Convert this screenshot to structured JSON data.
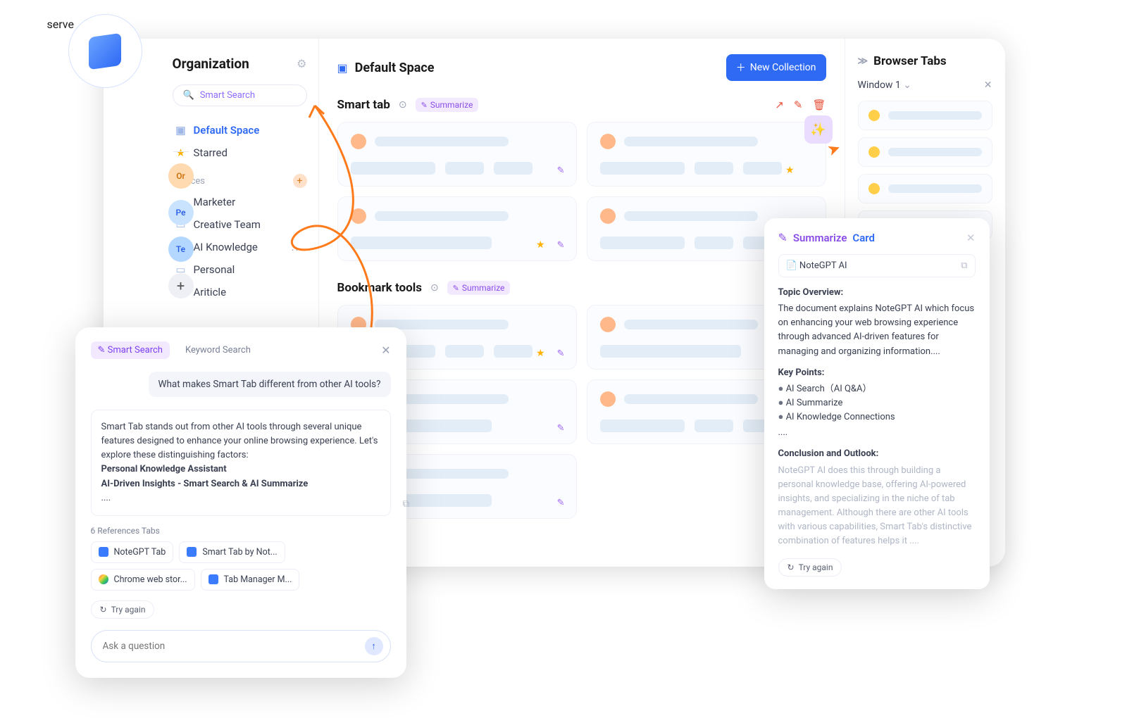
{
  "sidebar": {
    "title": "Organization",
    "search_placeholder": "Smart Search",
    "default_space": "Default Space",
    "starred": "Starred",
    "section_label": "Spaces",
    "spaces": [
      "Marketer",
      "Creative Team",
      "AI Knowledge",
      "Personal",
      "Ariticle"
    ]
  },
  "dock": {
    "or": "Or",
    "pe": "Pe",
    "te": "Te"
  },
  "header": {
    "space_title": "Default Space",
    "new_collection": "New Collection"
  },
  "collections": {
    "smart_tab": "Smart tab",
    "bookmark_tools": "Bookmark tools",
    "summarize_chip": "Summarize"
  },
  "browser_tabs": {
    "title": "Browser Tabs",
    "window": "Window 1"
  },
  "search_popup": {
    "tab_smart": "Smart Search",
    "tab_keyword": "Keyword Search",
    "question": "What makes Smart Tab different from other AI tools?",
    "answer_intro": "Smart Tab stands out from other AI tools through several unique features designed to enhance your online browsing experience. Let's explore these distinguishing factors:",
    "answer_b1": "Personal Knowledge Assistant",
    "answer_b2": "AI-Driven Insights - Smart Search & AI Summarize",
    "answer_ellipsis": "....",
    "refs_label": "6 References Tabs",
    "refs": [
      "NoteGPT  Tab",
      "Smart Tab by Not...",
      "Chrome web stor...",
      "Tab Manager M..."
    ],
    "try_again": "Try again",
    "ask_placeholder": "Ask a question"
  },
  "summary": {
    "title_a": "Summarize",
    "title_b": "Card",
    "source": "NoteGPT AI",
    "h1": "Topic Overview:",
    "p1": "The document explains NoteGPT AI which focus on enhancing your web browsing experience through advanced AI-driven features for managing and organizing information....",
    "h2": "Key Points:",
    "kp": [
      "AI Search（AI Q&A）",
      "AI Summarize",
      "AI Knowledge Connections"
    ],
    "kp_ell": "....",
    "h3": "Conclusion and Outlook:",
    "p3": "NoteGPT AI does this through building a personal knowledge base, offering AI-powered insights, and specializing in the niche of tab management. Although there are other AI tools with various capabilities, Smart Tab's distinctive combination of features helps it ....",
    "try_again": "Try again"
  }
}
